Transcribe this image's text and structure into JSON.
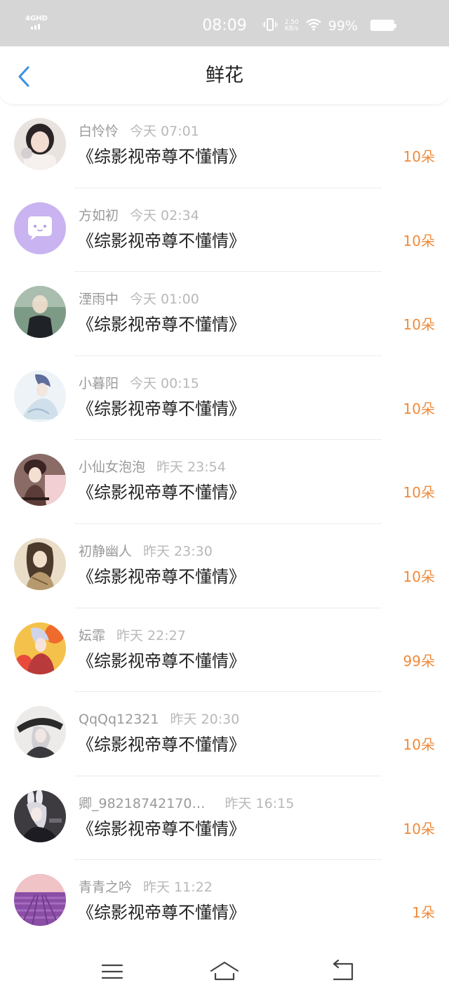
{
  "status_bar": {
    "network": "4GHD",
    "time": "08:09",
    "speed_top": "2.50",
    "speed_unit": "KB/s",
    "battery": "99%"
  },
  "header": {
    "title": "鲜花"
  },
  "colors": {
    "accent": "#f08a3a",
    "back": "#3a8ee6"
  },
  "items": [
    {
      "name": "白怜怜",
      "time": "今天 07:01",
      "book": "《综影视帝尊不懂情》",
      "count": "10朵"
    },
    {
      "name": "方如初",
      "time": "今天 02:34",
      "book": "《综影视帝尊不懂情》",
      "count": "10朵"
    },
    {
      "name": "湮雨中",
      "time": "今天 01:00",
      "book": "《综影视帝尊不懂情》",
      "count": "10朵"
    },
    {
      "name": "小暮阳",
      "time": "今天 00:15",
      "book": "《综影视帝尊不懂情》",
      "count": "10朵"
    },
    {
      "name": "小仙女泡泡",
      "time": "昨天 23:54",
      "book": "《综影视帝尊不懂情》",
      "count": "10朵"
    },
    {
      "name": "初静幽人",
      "time": "昨天 23:30",
      "book": "《综影视帝尊不懂情》",
      "count": "10朵"
    },
    {
      "name": "妘霏",
      "time": "昨天 22:27",
      "book": "《综影视帝尊不懂情》",
      "count": "99朵"
    },
    {
      "name": "QqQq12321",
      "time": "昨天 20:30",
      "book": "《综影视帝尊不懂情》",
      "count": "10朵"
    },
    {
      "name": "卿_98218742170…",
      "time": "昨天 16:15",
      "book": "《综影视帝尊不懂情》",
      "count": "10朵"
    },
    {
      "name": "青青之吟",
      "time": "昨天 11:22",
      "book": "《综影视帝尊不懂情》",
      "count": "1朵"
    }
  ],
  "nav": {
    "menu_icon": "menu-icon",
    "home_icon": "home-icon",
    "back_icon": "return-icon"
  }
}
